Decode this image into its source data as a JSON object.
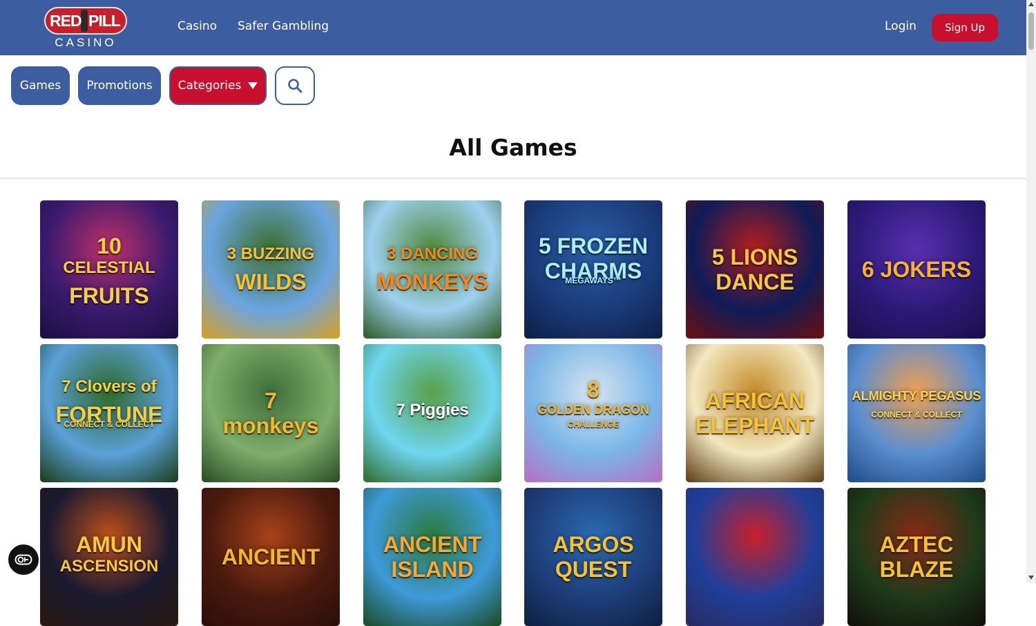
{
  "header": {
    "logo": {
      "top": "RED PILL",
      "left": "RED",
      "right": "PILL",
      "bottom": "CASINO"
    },
    "nav": [
      {
        "label": "Casino"
      },
      {
        "label": "Safer Gambling"
      }
    ],
    "login_label": "Login",
    "signup_label": "Sign Up"
  },
  "filters": {
    "games_label": "Games",
    "promotions_label": "Promotions",
    "categories_label": "Categories",
    "search_icon": "search-icon",
    "caret_icon": "caret-down-icon"
  },
  "page_title": "All Games",
  "games": [
    {
      "title_lines": [
        "10",
        "CELESTIAL",
        "FRUITS"
      ],
      "bg": [
        "#3a1a6e",
        "#c0306a",
        "#1a1040"
      ],
      "text_color": "#f5d142"
    },
    {
      "title_lines": [
        "3 BUZZING",
        "WILDS"
      ],
      "bg": [
        "#6aa5e0",
        "#3d6e2c",
        "#d8a020"
      ],
      "text_color": "#f6c232"
    },
    {
      "title_lines": [
        "3 DANCING",
        "MONKEYS"
      ],
      "bg": [
        "#9ed0f0",
        "#4f8a3a",
        "#2d5a22"
      ],
      "text_color": "#f08a1e"
    },
    {
      "title_lines": [
        "5 FROZEN",
        "CHARMS",
        "MEGAWAYS™"
      ],
      "bg": [
        "#1a3b7a",
        "#2c5fa8",
        "#0e1f46"
      ],
      "text_color": "#a8f0ff"
    },
    {
      "title_lines": [
        "5 LIONS",
        "DANCE"
      ],
      "bg": [
        "#0e1c58",
        "#b51d1d",
        "#6b0f0f"
      ],
      "text_color": "#f7c840"
    },
    {
      "title_lines": [
        "6 JOKERS"
      ],
      "bg": [
        "#2b1a78",
        "#5a2fb0",
        "#1a0f4a"
      ],
      "text_color": "#f7b232"
    },
    {
      "title_lines": [
        "7 Clovers of",
        "FORTUNE",
        "CONNECT & COLLECT"
      ],
      "bg": [
        "#5aa0d8",
        "#2e6a2a",
        "#1a3d18"
      ],
      "text_color": "#f5d142"
    },
    {
      "title_lines": [
        "7",
        "monkeys"
      ],
      "bg": [
        "#7fae6a",
        "#3f6e3a",
        "#2a4a26"
      ],
      "text_color": "#f3b72a"
    },
    {
      "title_lines": [
        "7 Piggies"
      ],
      "bg": [
        "#6fd6f0",
        "#58a048",
        "#2f6a26"
      ],
      "text_color": "#ffffff"
    },
    {
      "title_lines": [
        "8",
        "GOLDEN DRAGON",
        "CHALLENGE"
      ],
      "bg": [
        "#7ab6e8",
        "#d7e4ef",
        "#b66fc0"
      ],
      "text_color": "#f2b930"
    },
    {
      "title_lines": [
        "AFRICAN",
        "ELEPHANT"
      ],
      "bg": [
        "#f2e8c0",
        "#c48a28",
        "#5a3a14"
      ],
      "text_color": "#f6c232"
    },
    {
      "title_lines": [
        "ALMIGHTY PEGASUS",
        "CONNECT & COLLECT"
      ],
      "bg": [
        "#5a8ed0",
        "#f0a050",
        "#1f4a86"
      ],
      "text_color": "#ffd24a"
    },
    {
      "title_lines": [
        "AMUN",
        "ASCENSION"
      ],
      "bg": [
        "#1a1a30",
        "#c0501a",
        "#2a1a10"
      ],
      "text_color": "#f7c840"
    },
    {
      "title_lines": [
        "ANCIENT"
      ],
      "bg": [
        "#4a1a0e",
        "#a8421a",
        "#2a0e08"
      ],
      "text_color": "#f3b72a"
    },
    {
      "title_lines": [
        "ANCIENT",
        "ISLAND"
      ],
      "bg": [
        "#3e9ad8",
        "#2a7a3a",
        "#1a4a22"
      ],
      "text_color": "#f7a830"
    },
    {
      "title_lines": [
        "ARGOS",
        "QUEST"
      ],
      "bg": [
        "#1e3e7a",
        "#2a6ab0",
        "#0e2040"
      ],
      "text_color": "#f6c232"
    },
    {
      "title_lines": [
        ""
      ],
      "bg": [
        "#1f3f9a",
        "#c8202a",
        "#2a2a60"
      ],
      "text_color": "#ffffff"
    },
    {
      "title_lines": [
        "AZTEC",
        "BLAZE"
      ],
      "bg": [
        "#1e3a1a",
        "#8a2a14",
        "#120e0a"
      ],
      "text_color": "#f6c232"
    }
  ],
  "accessibility": {
    "icon": "accessibility-toggle-icon"
  }
}
